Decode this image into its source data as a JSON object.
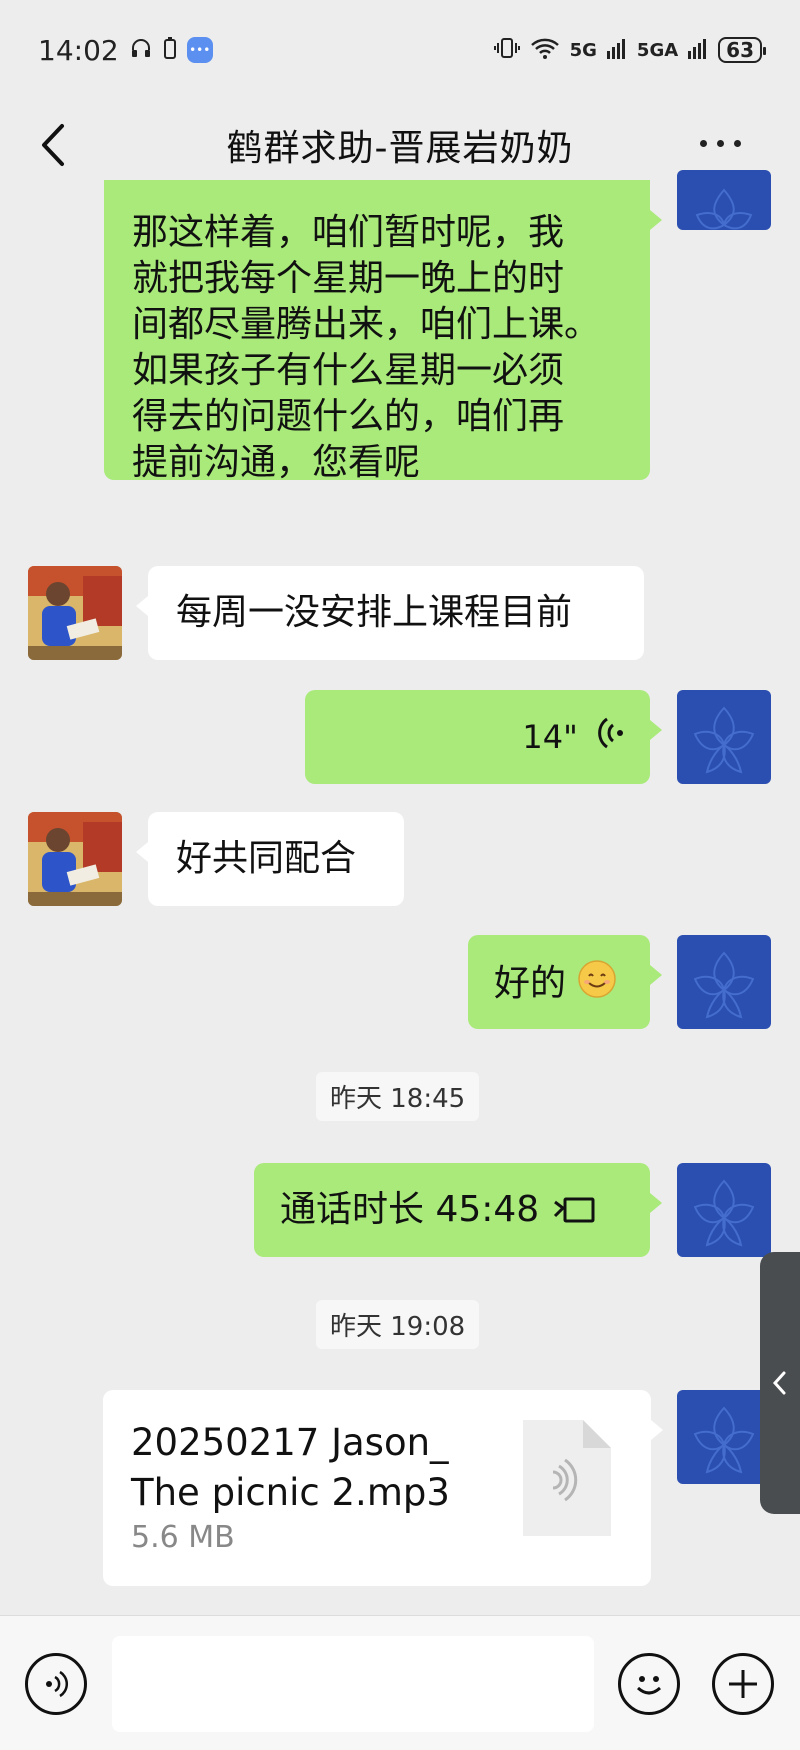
{
  "status_bar": {
    "time": "14:02",
    "network_5g": "5G",
    "network_5ga": "5GA",
    "battery": "63"
  },
  "header": {
    "title": "鹤群求助-晋展岩奶奶"
  },
  "messages": {
    "m1_text": "那这样着，咱们暂时呢，我就把我每个星期一晚上的时间都尽量腾出来，咱们上课。如果孩子有什么星期一必须得去的问题什么的，咱们再提前沟通，您看呢",
    "m1_lines": [
      "那这样着，咱们暂时呢，我",
      "就把我每个星期一晚上的时",
      "间都尽量腾出来，咱们上课。",
      "如果孩子有什么星期一必须",
      "得去的问题什么的，咱们再",
      "提前沟通，您看呢"
    ],
    "m2_text": "每周一没安排上课程目前",
    "m3_voice_duration": "14\"",
    "m4_text": "好共同配合",
    "m5_text": "好的",
    "time1": "昨天 18:45",
    "m6_text": "通话时长 45:48",
    "time2": "昨天 19:08",
    "file_name_line1": "20250217 Jason_",
    "file_name_line2": "The picnic 2.mp3",
    "file_size": "5.6 MB"
  },
  "icons": {
    "back": "chevron-left-icon",
    "more": "more-dots-icon",
    "voice": "voice-wave-icon",
    "video": "video-call-icon",
    "emoji": "emoji-icon",
    "plus": "plus-icon",
    "voice_input": "voice-input-icon",
    "file_audio": "audio-file-icon"
  },
  "colors": {
    "outgoing_bubble": "#a9ea7a",
    "incoming_bubble": "#ffffff",
    "background": "#ededed",
    "my_avatar": "#2a4fb0"
  }
}
